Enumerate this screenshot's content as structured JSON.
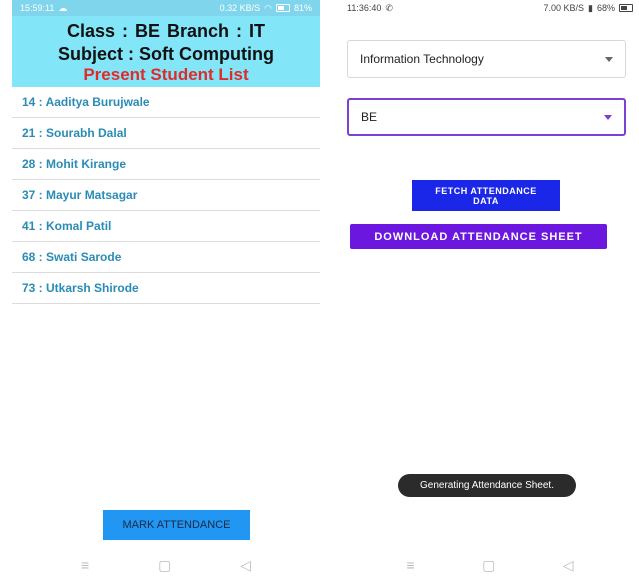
{
  "left": {
    "status": {
      "time": "15:59:11",
      "signal_text": "0.32 KB/S",
      "battery_text": "81%"
    },
    "header": {
      "class_line": "Class : BE   Branch : IT",
      "subject_line": "Subject : Soft Computing",
      "list_title": "Present Student List"
    },
    "students": [
      "14 : Aaditya Burujwale",
      "21 : Sourabh Dalal",
      "28 : Mohit Kirange",
      "37 : Mayur Matsagar",
      "41 : Komal Patil",
      "68 : Swati Sarode",
      "73 : Utkarsh Shirode"
    ],
    "mark_button": "MARK ATTENDANCE"
  },
  "right": {
    "status": {
      "time": "11:36:40",
      "signal_text": "7.00 KB/S",
      "battery_text": "68%"
    },
    "branch_select": "Information Technology",
    "class_select": "BE",
    "fetch_button": "FETCH ATTENDANCE\nDATA",
    "download_button": "DOWNLOAD ATTENDANCE SHEET",
    "toast": "Generating Attendance Sheet."
  },
  "nav": {
    "menu_icon": "≡",
    "home_icon": "▢",
    "back_icon": "◁"
  },
  "colors": {
    "header_bg": "#82e5f8",
    "list_text": "#2a8cb6",
    "title_red": "#e02b2b",
    "mark_button": "#2196f3",
    "fetch_button": "#1a27e8",
    "download_button": "#6c17e0",
    "select_focus": "#7e3fd6"
  }
}
